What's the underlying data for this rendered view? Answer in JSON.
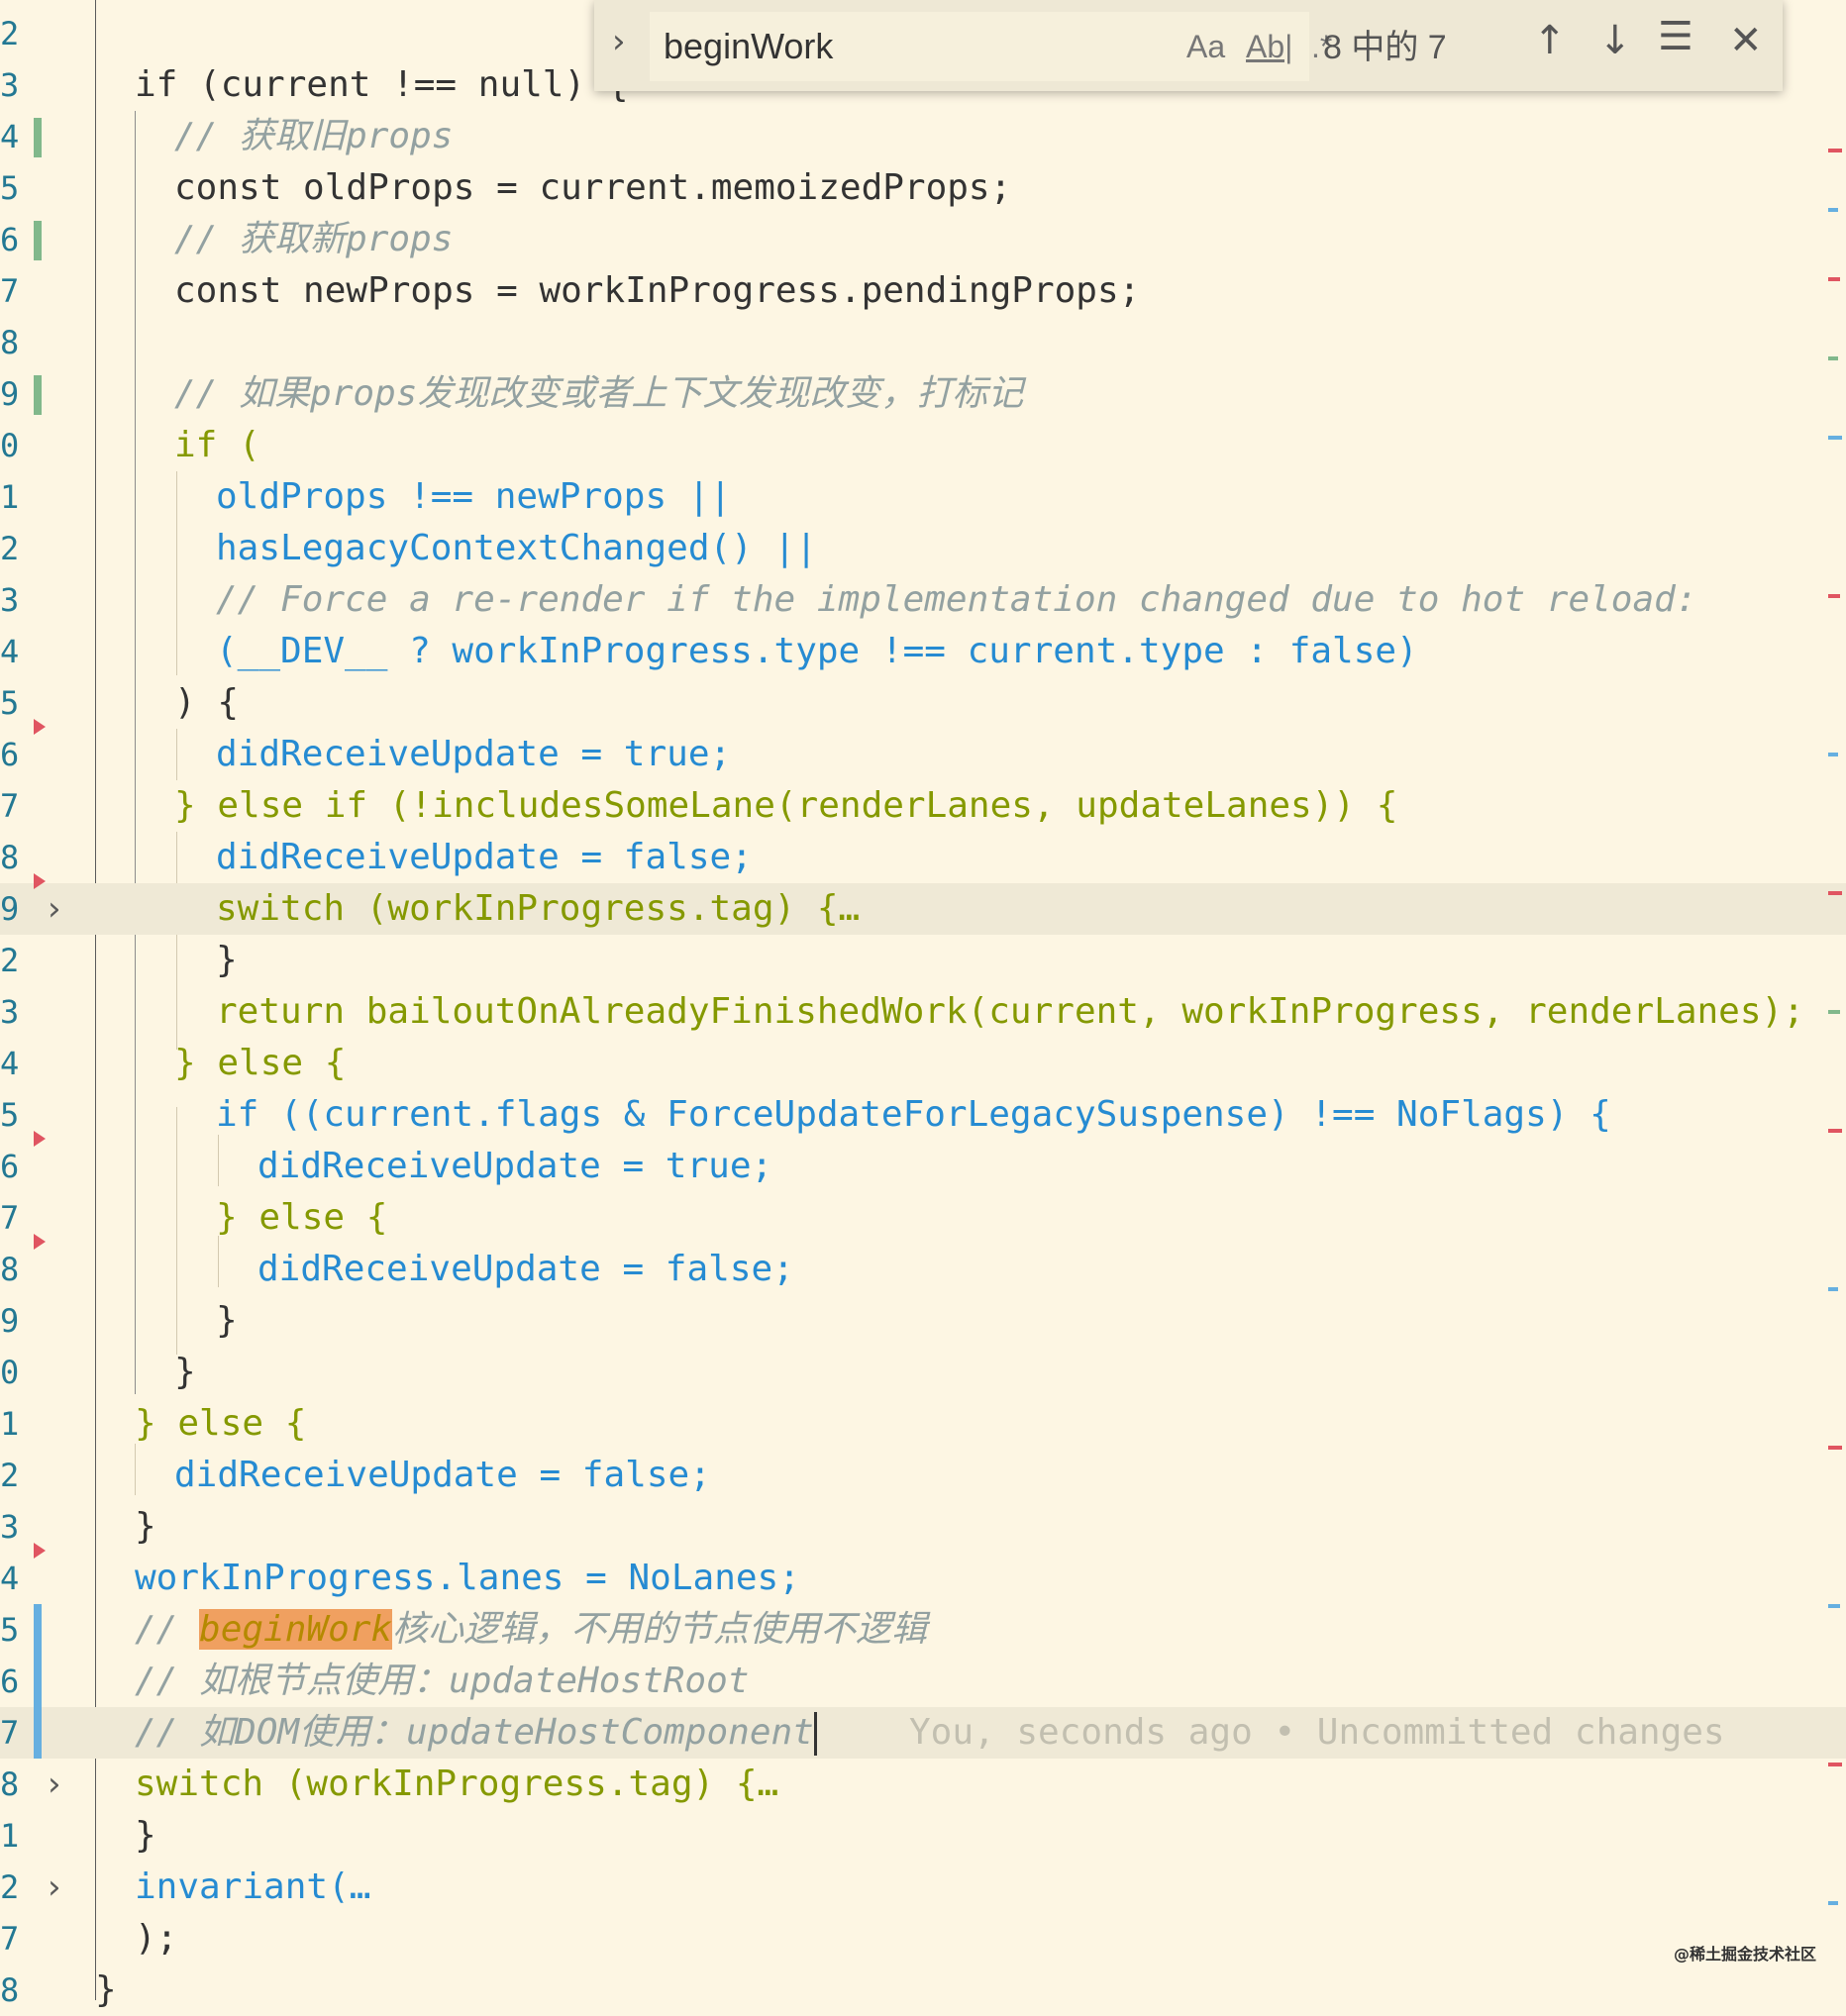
{
  "find_widget": {
    "query": "beginWork",
    "match_case_label": "Aa",
    "whole_word_label": "Ab|",
    "regex_label": ".*",
    "result_count": "8 中的 7",
    "toggle_icon": "chevron-right-icon",
    "prev_icon": "arrow-up-icon",
    "next_icon": "arrow-down-icon",
    "selection_icon": "find-in-selection-icon",
    "close_icon": "close-icon"
  },
  "editor": {
    "line_numbers": [
      "2",
      "3",
      "4",
      "5",
      "6",
      "7",
      "8",
      "9",
      "0",
      "1",
      "2",
      "3",
      "4",
      "5",
      "6",
      "7",
      "8",
      "9",
      "2",
      "3",
      "4",
      "5",
      "6",
      "7",
      "8",
      "9",
      "0",
      "1",
      "2",
      "3",
      "4",
      "5",
      "6",
      "7",
      "8",
      "1",
      "2",
      "7",
      "8"
    ],
    "blame": "You, seconds ago • Uncommitted changes",
    "lines": {
      "l23": "if (current !== null) {",
      "l24_c": "// 获取旧props",
      "l25": "const oldProps = current.memoizedProps;",
      "l26_c": "// 获取新props",
      "l27": "const newProps = workInProgress.pendingProps;",
      "l29_c": "// 如果props发现改变或者上下文发现改变，打标记",
      "l30": "if (",
      "l31": "oldProps !== newProps ||",
      "l32": "hasLegacyContextChanged() ||",
      "l33_c": "// Force a re-render if the implementation changed due to hot reload:",
      "l34": "(__DEV__ ? workInProgress.type !== current.type : false)",
      "l35": ") {",
      "l36": "didReceiveUpdate = true;",
      "l37": "} else if (!includesSomeLane(renderLanes, updateLanes)) {",
      "l38": "didReceiveUpdate = false;",
      "l39": "switch (workInProgress.tag) {…",
      "l42": "}",
      "l43": "return bailoutOnAlreadyFinishedWork(current, workInProgress, renderLanes);",
      "l44": "} else {",
      "l45": "if ((current.flags & ForceUpdateForLegacySuspense) !== NoFlags) {",
      "l46": "didReceiveUpdate = true;",
      "l47": "} else {",
      "l48": "didReceiveUpdate = false;",
      "l49": "}",
      "l50": "}",
      "l51": "} else {",
      "l52": "didReceiveUpdate = false;",
      "l53": "}",
      "l54": "workInProgress.lanes = NoLanes;",
      "l55_prefix": "// ",
      "l55_match": "beginWork",
      "l55_rest": "核心逻辑，不用的节点使用不逻辑",
      "l56_c": "// 如根节点使用：updateHostRoot",
      "l57_c": "// 如DOM使用：updateHostComponent",
      "l58": "switch (workInProgress.tag) {…",
      "l61": "}",
      "l62": "invariant(…",
      "l67": ");",
      "l68": "}"
    }
  },
  "watermark": "@稀土掘金技术社区",
  "colors": {
    "background": "#fdf6e3",
    "keyword": "#859900",
    "variable": "#268bd2",
    "literal": "#b58900",
    "comment": "#93a1a1",
    "match": "#f0a060"
  }
}
